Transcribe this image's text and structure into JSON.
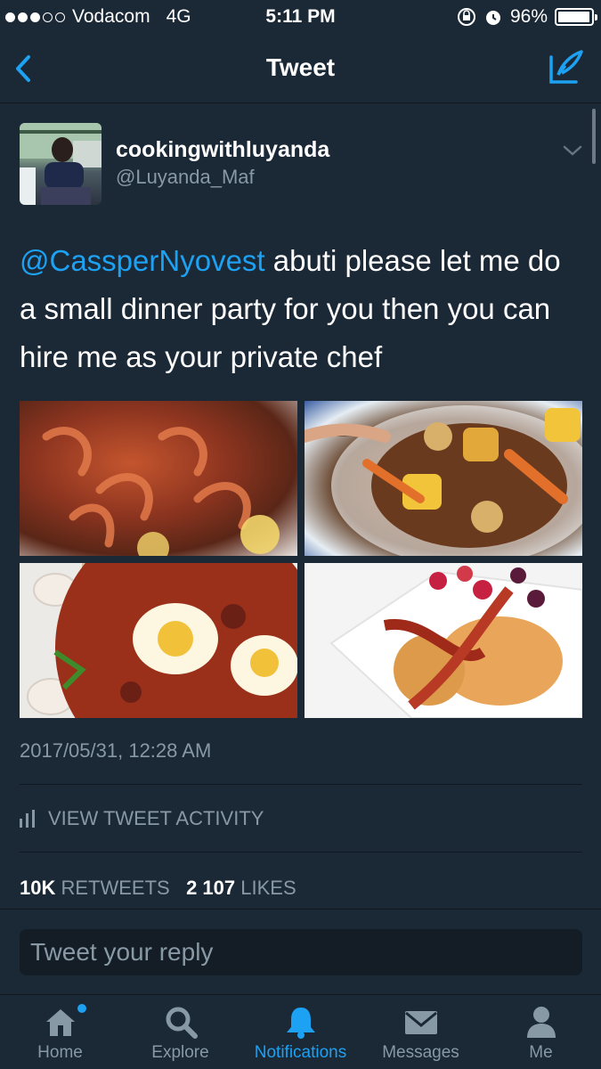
{
  "status_bar": {
    "carrier": "Vodacom",
    "network": "4G",
    "time": "5:11 PM",
    "battery_percent": "96%",
    "battery_level": 0.96,
    "signal_bars_filled": 3,
    "signal_bars_total": 5
  },
  "nav": {
    "title": "Tweet"
  },
  "tweet": {
    "display_name": "cookingwithluyanda",
    "handle": "@Luyanda_Maf",
    "mention": "@CassperNyovest",
    "text": " abuti please let me do a small dinner party for you then you can hire me as your private chef",
    "timestamp": "2017/05/31, 12:28 AM",
    "activity_label": "VIEW TWEET ACTIVITY",
    "retweet_count": "10K",
    "retweet_label": "RETWEETS",
    "like_count": "2 107",
    "like_label": "LIKES"
  },
  "reply": {
    "placeholder": "Tweet your reply"
  },
  "tabs": [
    {
      "label": "Home",
      "icon": "home-icon"
    },
    {
      "label": "Explore",
      "icon": "search-icon"
    },
    {
      "label": "Notifications",
      "icon": "bell-icon"
    },
    {
      "label": "Messages",
      "icon": "envelope-icon"
    },
    {
      "label": "Me",
      "icon": "person-icon"
    }
  ],
  "colors": {
    "background": "#1b2836",
    "accent": "#1da1f2",
    "muted": "#8899a6"
  }
}
